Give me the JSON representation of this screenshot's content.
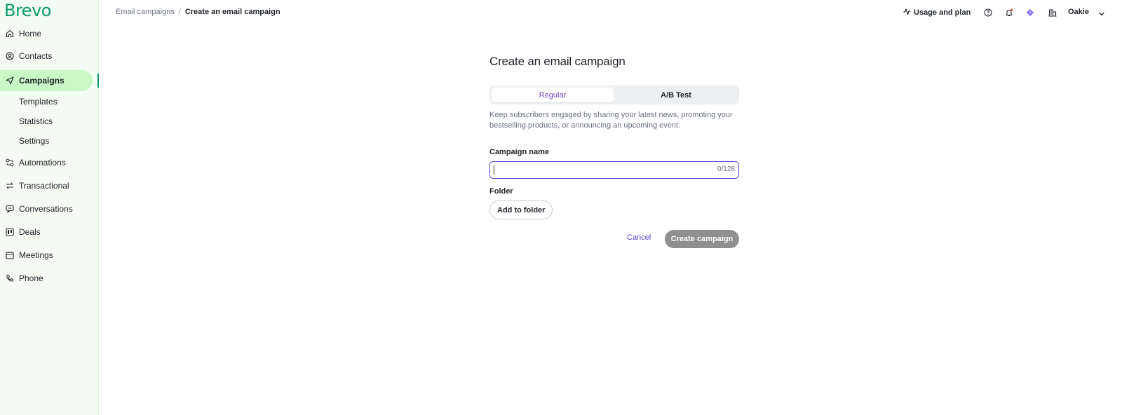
{
  "brand": {
    "name": "Brevo",
    "color": "#0b996e"
  },
  "sidebar": {
    "items": [
      {
        "label": "Home",
        "icon": "home-icon"
      },
      {
        "label": "Contacts",
        "icon": "contacts-icon"
      },
      {
        "label": "Campaigns",
        "icon": "send-icon",
        "active": true
      },
      {
        "label": "Automations",
        "icon": "automation-icon"
      },
      {
        "label": "Transactional",
        "icon": "transactional-icon"
      },
      {
        "label": "Conversations",
        "icon": "chat-icon"
      },
      {
        "label": "Deals",
        "icon": "deals-icon"
      },
      {
        "label": "Meetings",
        "icon": "calendar-icon"
      },
      {
        "label": "Phone",
        "icon": "phone-icon"
      }
    ],
    "sub_items": [
      {
        "label": "Templates"
      },
      {
        "label": "Statistics"
      },
      {
        "label": "Settings"
      }
    ]
  },
  "breadcrumb": {
    "parent": "Email campaigns",
    "separator": "/",
    "current": "Create an email campaign"
  },
  "header": {
    "usage_label": "Usage and plan",
    "user_name": "Oakie"
  },
  "form": {
    "title": "Create an email campaign",
    "tabs": [
      {
        "label": "Regular",
        "selected": true
      },
      {
        "label": "A/B Test",
        "selected": false
      }
    ],
    "description": "Keep subscribers engaged by sharing your latest news, promoting your bestselling products, or announcing an upcoming event.",
    "campaign_name_label": "Campaign name",
    "campaign_name_value": "",
    "campaign_name_counter": "0/128",
    "folder_label": "Folder",
    "add_folder_button": "Add to folder",
    "cancel_button": "Cancel",
    "create_button": "Create campaign"
  },
  "colors": {
    "accent": "#5a3fd1",
    "active_nav_bg": "#c9f7c6",
    "sidebar_bg": "#f3fcf2",
    "disabled_button": "#8f8f8f"
  }
}
